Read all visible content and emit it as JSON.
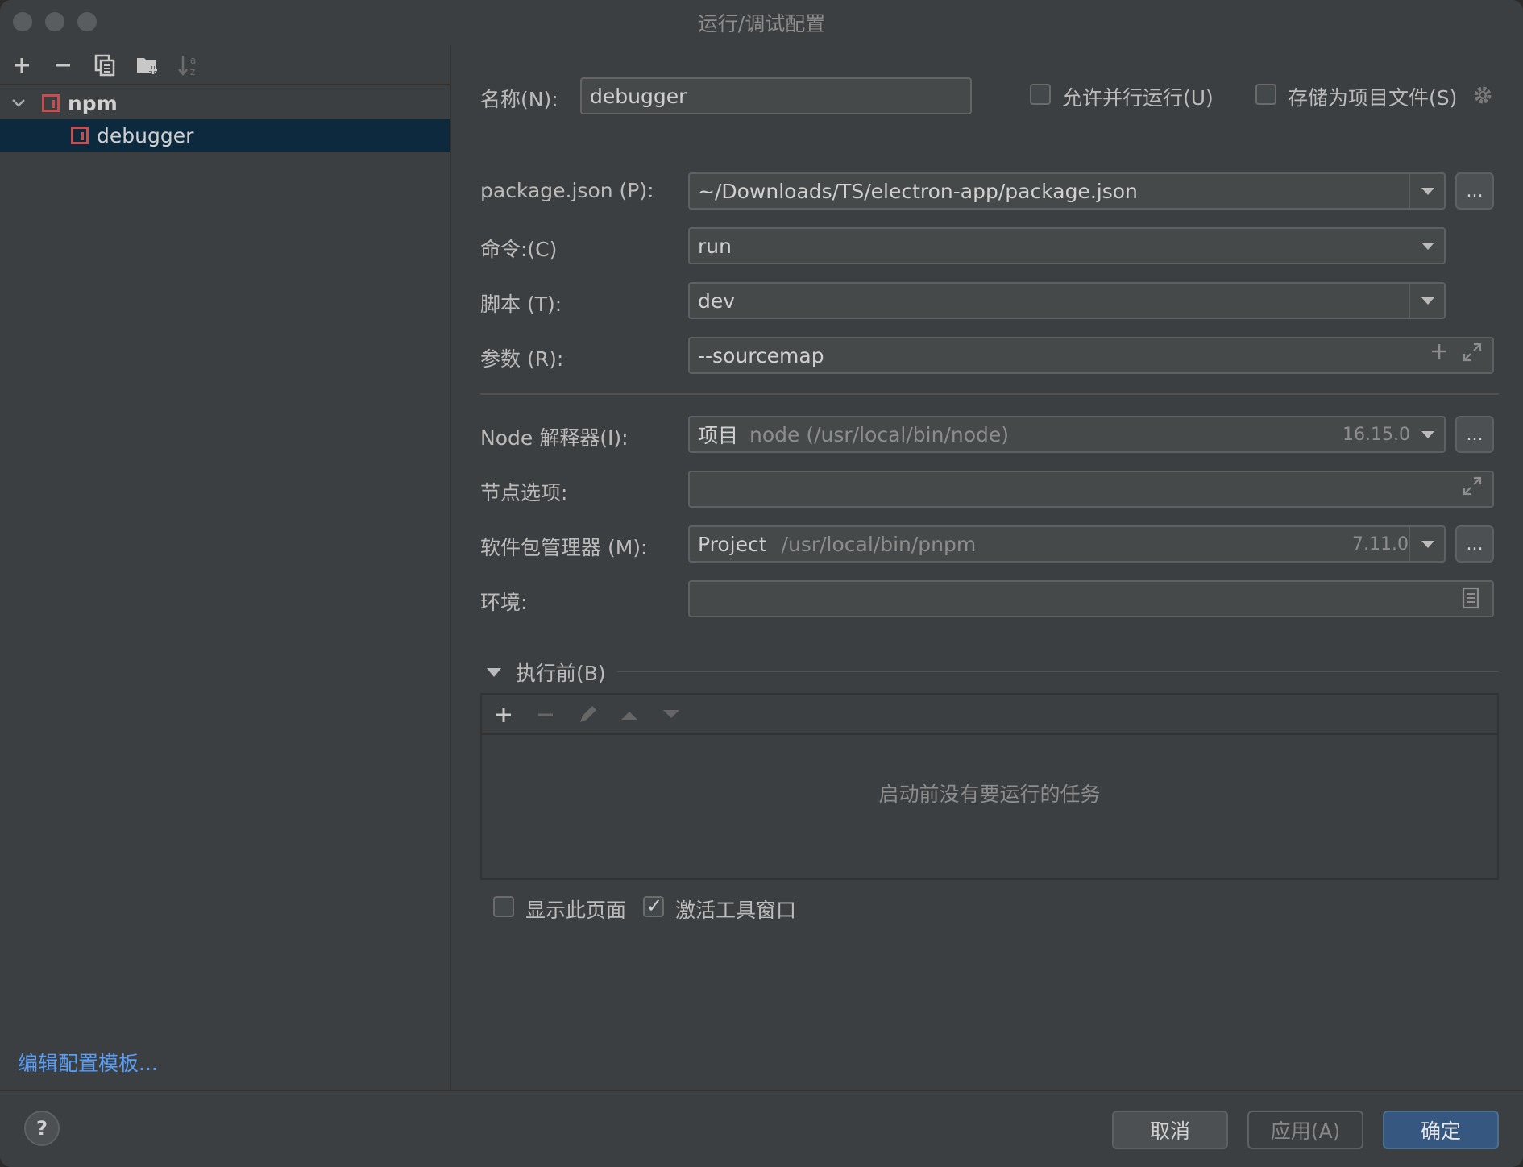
{
  "window": {
    "title": "运行/调试配置"
  },
  "left_toolbar": {
    "icons": [
      "add-icon",
      "remove-icon",
      "copy-icon",
      "folder-add-icon",
      "sort-az-icon"
    ]
  },
  "tree": {
    "group_label": "npm",
    "item_label": "debugger"
  },
  "edit_templates_link": "编辑配置模板...",
  "form": {
    "name_label": "名称(N):",
    "name_value": "debugger",
    "allow_parallel_label": "允许并行运行(U)",
    "store_as_project_label": "存储为项目文件(S)",
    "package_json_label": "package.json (P):",
    "package_json_value": "~/Downloads/TS/electron-app/package.json",
    "command_label": "命令:(C)",
    "command_value": "run",
    "script_label": "脚本 (T):",
    "script_value": "dev",
    "args_label": "参数 (R):",
    "args_value": "--sourcemap",
    "node_label": "Node 解释器(I):",
    "node_scope": "项目",
    "node_path": "node (/usr/local/bin/node)",
    "node_version": "16.15.0",
    "node_options_label": "节点选项:",
    "node_options_value": "",
    "pkg_manager_label": "软件包管理器 (M):",
    "pkg_manager_scope": "Project",
    "pkg_manager_path": "/usr/local/bin/pnpm",
    "pkg_manager_version": "7.11.0",
    "env_label": "环境:",
    "env_value": "",
    "browse_label": "..."
  },
  "before_launch": {
    "header": "执行前(B)",
    "empty_message": "启动前没有要运行的任务",
    "show_page_label": "显示此页面",
    "activate_tool_window_label": "激活工具窗口",
    "show_page_checked": false,
    "activate_tool_window_checked": true
  },
  "buttons": {
    "help": "?",
    "cancel": "取消",
    "apply": "应用(A)",
    "ok": "确定"
  },
  "colors": {
    "accent_link": "#589df6",
    "selection": "#0d293e",
    "primary_button": "#365880"
  }
}
